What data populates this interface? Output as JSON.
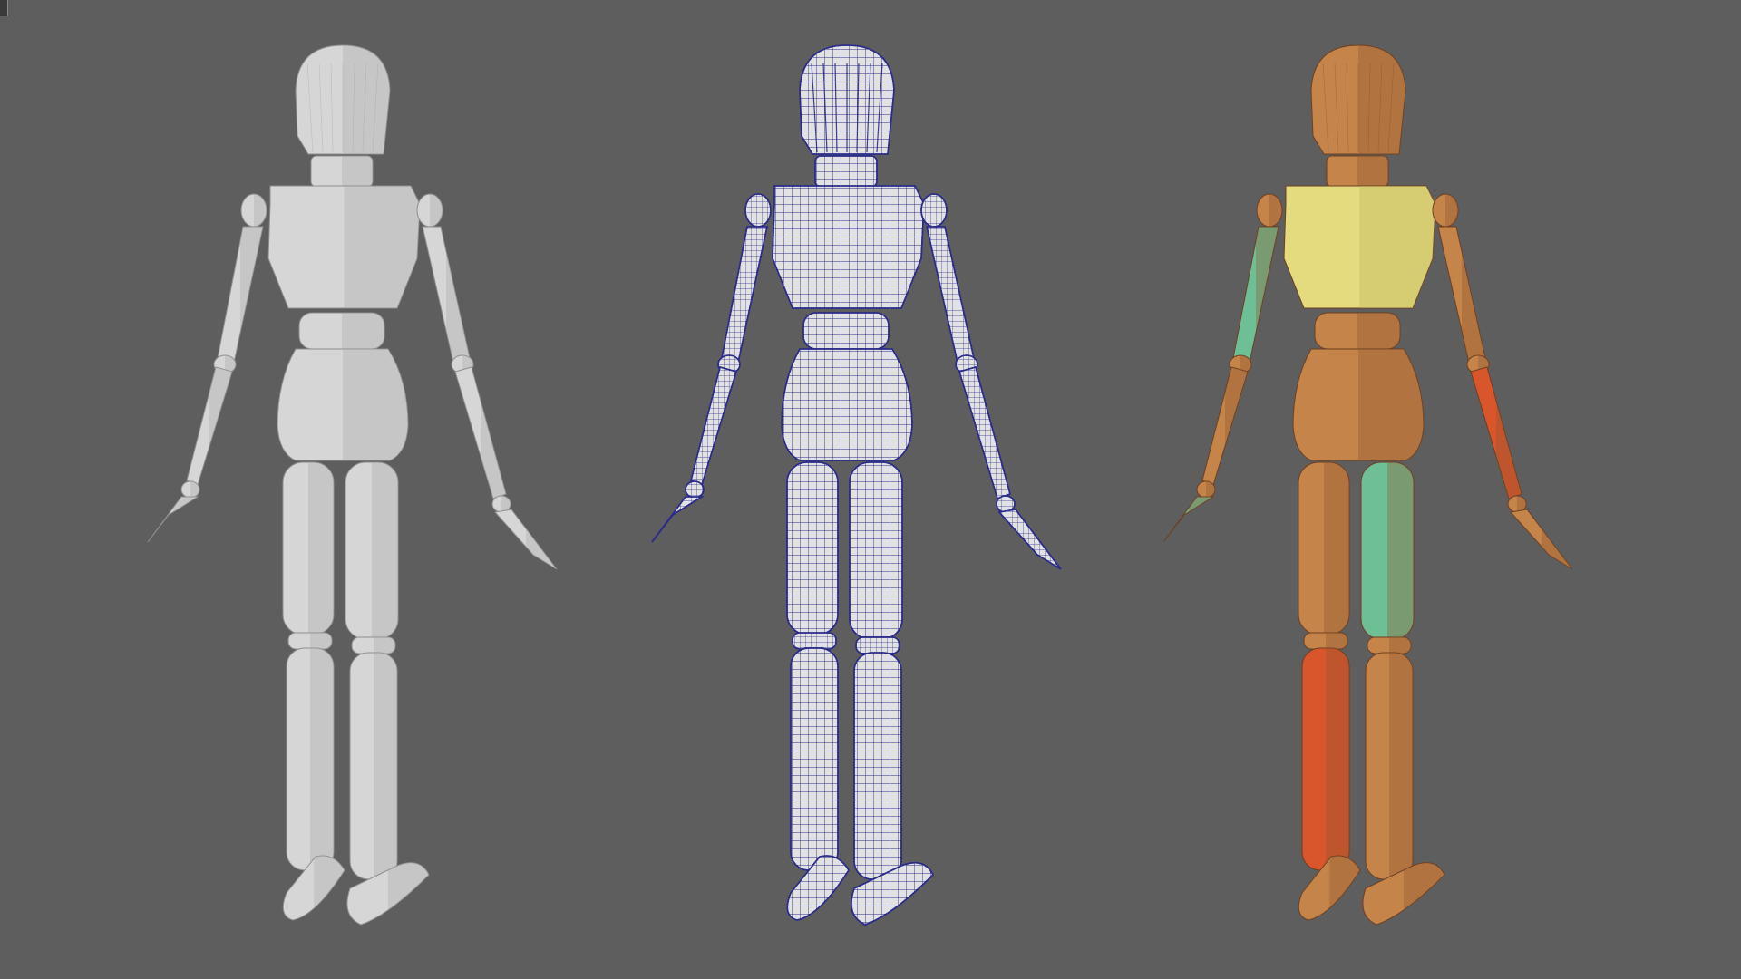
{
  "scene": {
    "background": "#5e5e5e",
    "figures": [
      {
        "id": "shaded",
        "display": "smooth-shaded",
        "base": "#d6d6d6",
        "shade": "#a9a9a9",
        "edge": "#8f8f8f"
      },
      {
        "id": "wireframe",
        "display": "wireframe-on-shaded",
        "base": "#e2e2e2",
        "shade": "#b8b8bf",
        "wire": "#2a2c8a"
      },
      {
        "id": "textured",
        "display": "textured",
        "base": "#c4844a",
        "shade": "#8e5630",
        "edge": "#6e3f20",
        "chest": "#e4da7e",
        "chestShade": "#bdb35c",
        "accentGreen": "#6fbf96",
        "accentRed": "#d9552b"
      }
    ]
  }
}
